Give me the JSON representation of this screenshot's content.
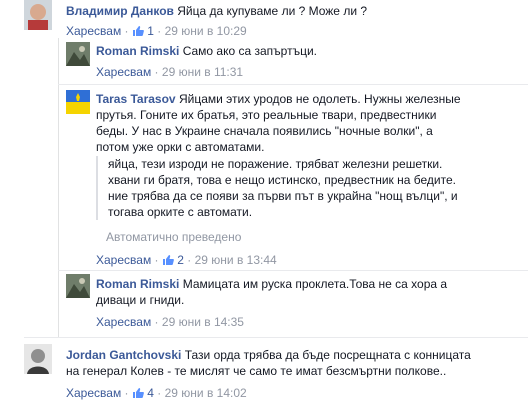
{
  "comments": [
    {
      "author": "Владимир Данков",
      "text": "Яйца да купуваме ли ? Може ли ?",
      "like_label": "Харесвам",
      "like_count": "1",
      "time": "29 юни в 10:29"
    },
    {
      "author": "Roman Rimski",
      "text": "Само ако са запъртъци.",
      "like_label": "Харесвам",
      "time": "29 юни в 11:31"
    },
    {
      "author": "Taras Tarasov",
      "text_lines": [
        "Яйцами этих уродов не одолеть. Нужны железные",
        "прутья. Гоните их братья, это реальные твари, предвестники",
        "беды. У нас в Украине сначала появились \"ночные волки\", а",
        "потом уже орки с автоматами."
      ],
      "translation_lines": [
        "яйца, тези изроди не поражение. трябват железни решетки.",
        "хвани ги братя, това е нещо истинско, предвестник на бедите.",
        "ние трябва да се появи за първи път в украйна \"нощ вълци\", и",
        "тогава орките с автомати."
      ],
      "translation_note": "Автоматично преведено",
      "like_label": "Харесвам",
      "like_count": "2",
      "time": "29 юни в 13:44"
    },
    {
      "author": "Roman Rimski",
      "text_lines": [
        "Мамицата им руска проклета.Това не са хора а",
        "диваци и гниди."
      ],
      "like_label": "Харесвам",
      "time": "29 юни в 14:35"
    },
    {
      "author": "Jordan Gantchovski",
      "text_lines": [
        "Тази орда трябва да бъде посрещната с конницата",
        "на генерал Колев - те мислят че само те имат безсмъртни полкове.."
      ],
      "like_label": "Харесвам",
      "like_count": "4",
      "time": "29 юни в 14:02"
    }
  ],
  "separator": "·"
}
